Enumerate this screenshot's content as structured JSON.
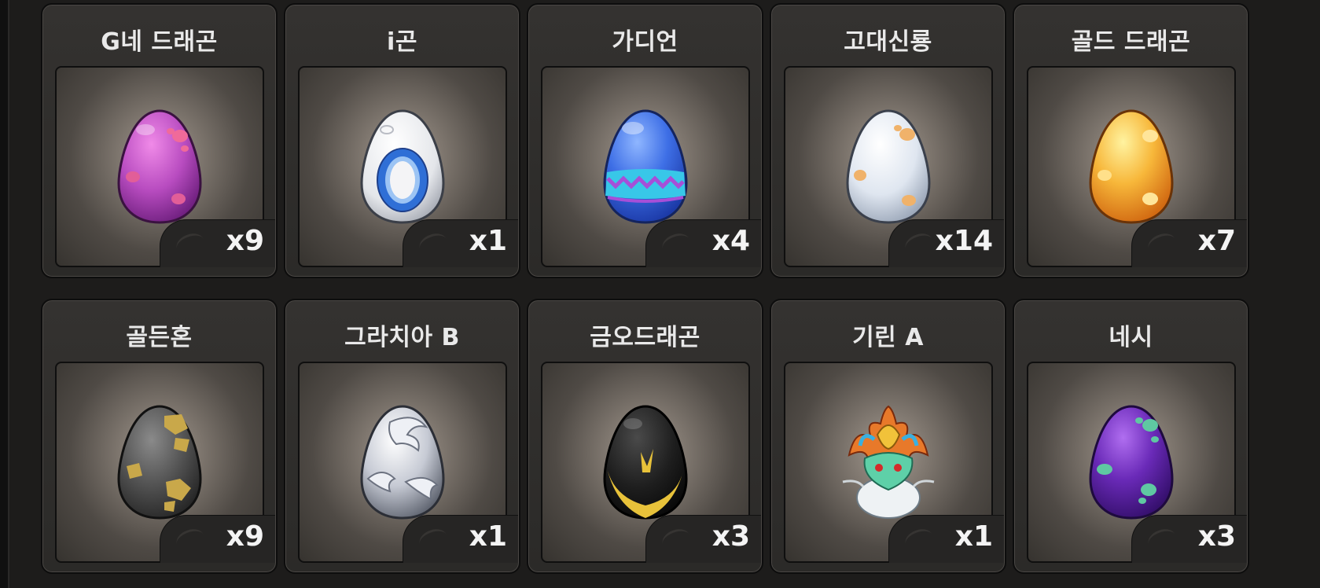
{
  "items": [
    {
      "name": "G네 드래곤",
      "qty": "x9"
    },
    {
      "name": "i곤",
      "qty": "x1"
    },
    {
      "name": "가디언",
      "qty": "x4"
    },
    {
      "name": "고대신룡",
      "qty": "x14"
    },
    {
      "name": "골드 드래곤",
      "qty": "x7"
    },
    {
      "name": "골든혼",
      "qty": "x9"
    },
    {
      "name": "그라치아 B",
      "qty": "x1"
    },
    {
      "name": "금오드래곤",
      "qty": "x3"
    },
    {
      "name": "기린 A",
      "qty": "x1"
    },
    {
      "name": "네시",
      "qty": "x3"
    }
  ],
  "egg_icons": [
    "purple-spotted-egg-icon",
    "white-ring-egg-icon",
    "blue-zigzag-egg-icon",
    "white-spotted-egg-icon",
    "gold-spotted-egg-icon",
    "gray-gold-spotted-egg-icon",
    "silver-swirl-egg-icon",
    "black-gold-egg-icon",
    "qilin-dragon-head-icon",
    "violet-green-spotted-egg-icon"
  ]
}
